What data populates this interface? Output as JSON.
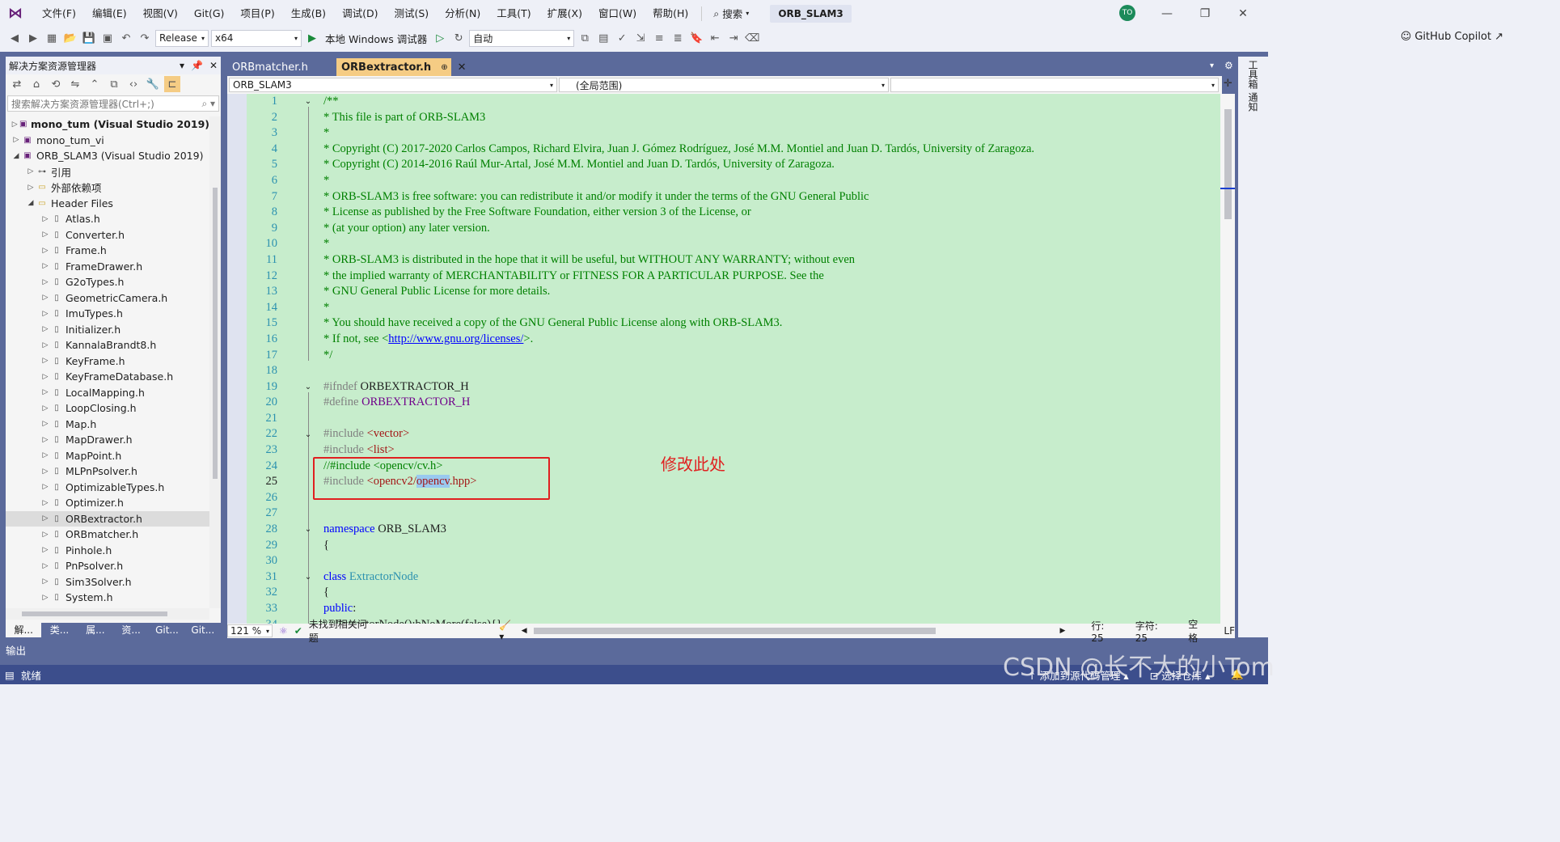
{
  "menubar": {
    "items": [
      "文件(F)",
      "编辑(E)",
      "视图(V)",
      "Git(G)",
      "项目(P)",
      "生成(B)",
      "调试(D)",
      "测试(S)",
      "分析(N)",
      "工具(T)",
      "扩展(X)",
      "窗口(W)",
      "帮助(H)"
    ],
    "search_label": "搜索",
    "solution_title": "ORB_SLAM3",
    "avatar_initials": "TO"
  },
  "toolbar": {
    "config": "Release",
    "platform": "x64",
    "debugger_label": "本地 Windows 调试器",
    "auto_combo": "自动",
    "copilot_label": "GitHub Copilot"
  },
  "solution_explorer": {
    "title": "解决方案资源管理器",
    "search_placeholder": "搜索解决方案资源管理器(Ctrl+;)",
    "items": [
      {
        "label": "mono_tum (Visual Studio 2019)",
        "bold": true,
        "arrow": "▷",
        "indent": 0,
        "icon": "project"
      },
      {
        "label": "mono_tum_vi",
        "bold": false,
        "arrow": "▷",
        "indent": 0,
        "icon": "project"
      },
      {
        "label": "ORB_SLAM3 (Visual Studio 2019)",
        "bold": false,
        "arrow": "◢",
        "indent": 0,
        "icon": "project"
      },
      {
        "label": "引用",
        "bold": false,
        "arrow": "▷",
        "indent": 1,
        "icon": "ref"
      },
      {
        "label": "外部依赖项",
        "bold": false,
        "arrow": "▷",
        "indent": 1,
        "icon": "folder"
      },
      {
        "label": "Header Files",
        "bold": false,
        "arrow": "◢",
        "indent": 1,
        "icon": "folder"
      },
      {
        "label": "Atlas.h",
        "bold": false,
        "arrow": "▷",
        "indent": 2,
        "icon": "file"
      },
      {
        "label": "Converter.h",
        "bold": false,
        "arrow": "▷",
        "indent": 2,
        "icon": "file"
      },
      {
        "label": "Frame.h",
        "bold": false,
        "arrow": "▷",
        "indent": 2,
        "icon": "file"
      },
      {
        "label": "FrameDrawer.h",
        "bold": false,
        "arrow": "▷",
        "indent": 2,
        "icon": "file"
      },
      {
        "label": "G2oTypes.h",
        "bold": false,
        "arrow": "▷",
        "indent": 2,
        "icon": "file"
      },
      {
        "label": "GeometricCamera.h",
        "bold": false,
        "arrow": "▷",
        "indent": 2,
        "icon": "file"
      },
      {
        "label": "ImuTypes.h",
        "bold": false,
        "arrow": "▷",
        "indent": 2,
        "icon": "file"
      },
      {
        "label": "Initializer.h",
        "bold": false,
        "arrow": "▷",
        "indent": 2,
        "icon": "file"
      },
      {
        "label": "KannalaBrandt8.h",
        "bold": false,
        "arrow": "▷",
        "indent": 2,
        "icon": "file"
      },
      {
        "label": "KeyFrame.h",
        "bold": false,
        "arrow": "▷",
        "indent": 2,
        "icon": "file"
      },
      {
        "label": "KeyFrameDatabase.h",
        "bold": false,
        "arrow": "▷",
        "indent": 2,
        "icon": "file"
      },
      {
        "label": "LocalMapping.h",
        "bold": false,
        "arrow": "▷",
        "indent": 2,
        "icon": "file"
      },
      {
        "label": "LoopClosing.h",
        "bold": false,
        "arrow": "▷",
        "indent": 2,
        "icon": "file"
      },
      {
        "label": "Map.h",
        "bold": false,
        "arrow": "▷",
        "indent": 2,
        "icon": "file"
      },
      {
        "label": "MapDrawer.h",
        "bold": false,
        "arrow": "▷",
        "indent": 2,
        "icon": "file"
      },
      {
        "label": "MapPoint.h",
        "bold": false,
        "arrow": "▷",
        "indent": 2,
        "icon": "file"
      },
      {
        "label": "MLPnPsolver.h",
        "bold": false,
        "arrow": "▷",
        "indent": 2,
        "icon": "file"
      },
      {
        "label": "OptimizableTypes.h",
        "bold": false,
        "arrow": "▷",
        "indent": 2,
        "icon": "file"
      },
      {
        "label": "Optimizer.h",
        "bold": false,
        "arrow": "▷",
        "indent": 2,
        "icon": "file"
      },
      {
        "label": "ORBextractor.h",
        "bold": false,
        "arrow": "▷",
        "indent": 2,
        "icon": "file",
        "selected": true
      },
      {
        "label": "ORBmatcher.h",
        "bold": false,
        "arrow": "▷",
        "indent": 2,
        "icon": "file"
      },
      {
        "label": "Pinhole.h",
        "bold": false,
        "arrow": "▷",
        "indent": 2,
        "icon": "file"
      },
      {
        "label": "PnPsolver.h",
        "bold": false,
        "arrow": "▷",
        "indent": 2,
        "icon": "file"
      },
      {
        "label": "Sim3Solver.h",
        "bold": false,
        "arrow": "▷",
        "indent": 2,
        "icon": "file"
      },
      {
        "label": "System.h",
        "bold": false,
        "arrow": "▷",
        "indent": 2,
        "icon": "file"
      }
    ],
    "bottom_tabs": [
      "解...",
      "类...",
      "属...",
      "资...",
      "Git...",
      "Git..."
    ]
  },
  "editor": {
    "tabs": [
      {
        "label": "ORBmatcher.h",
        "active": false
      },
      {
        "label": "ORBextractor.h",
        "active": true
      }
    ],
    "nav_project": "ORB_SLAM3",
    "nav_scope": "(全局范围)",
    "nav_member": "",
    "current_line": 25,
    "lines": [
      [
        [
          "c-comment",
          "/**"
        ]
      ],
      [
        [
          "c-comment",
          "* This file is part of ORB-SLAM3"
        ]
      ],
      [
        [
          "c-comment",
          "*"
        ]
      ],
      [
        [
          "c-comment",
          "* Copyright (C) 2017-2020 Carlos Campos, Richard Elvira, Juan J. Gómez Rodríguez, José M.M. Montiel and Juan D. Tardós, University of Zaragoza."
        ]
      ],
      [
        [
          "c-comment",
          "* Copyright (C) 2014-2016 Raúl Mur-Artal, José M.M. Montiel and Juan D. Tardós, University of Zaragoza."
        ]
      ],
      [
        [
          "c-comment",
          "*"
        ]
      ],
      [
        [
          "c-comment",
          "* ORB-SLAM3 is free software: you can redistribute it and/or modify it under the terms of the GNU General Public"
        ]
      ],
      [
        [
          "c-comment",
          "* License as published by the Free Software Foundation, either version 3 of the License, or"
        ]
      ],
      [
        [
          "c-comment",
          "* (at your option) any later version."
        ]
      ],
      [
        [
          "c-comment",
          "*"
        ]
      ],
      [
        [
          "c-comment",
          "* ORB-SLAM3 is distributed in the hope that it will be useful, but WITHOUT ANY WARRANTY; without even"
        ]
      ],
      [
        [
          "c-comment",
          "* the implied warranty of MERCHANTABILITY or FITNESS FOR A PARTICULAR PURPOSE. See the"
        ]
      ],
      [
        [
          "c-comment",
          "* GNU General Public License for more details."
        ]
      ],
      [
        [
          "c-comment",
          "*"
        ]
      ],
      [
        [
          "c-comment",
          "* You should have received a copy of the GNU General Public License along with ORB-SLAM3."
        ]
      ],
      [
        [
          "c-comment",
          "* If not, see <"
        ],
        [
          "c-link",
          "http://www.gnu.org/licenses/"
        ],
        [
          "c-comment",
          ">."
        ]
      ],
      [
        [
          "c-comment",
          "*/"
        ]
      ],
      [
        [
          "c-plain",
          ""
        ]
      ],
      [
        [
          "c-pre",
          "#ifndef "
        ],
        [
          "c-plain",
          "ORBEXTRACTOR_H"
        ]
      ],
      [
        [
          "c-pre",
          "#define "
        ],
        [
          "c-macro",
          "ORBEXTRACTOR_H"
        ]
      ],
      [
        [
          "c-plain",
          ""
        ]
      ],
      [
        [
          "c-pre",
          "#include "
        ],
        [
          "c-str",
          "<vector>"
        ]
      ],
      [
        [
          "c-pre",
          "#include "
        ],
        [
          "c-str",
          "<list>"
        ]
      ],
      [
        [
          "c-comment",
          "//#include <opencv/cv.h>"
        ]
      ],
      [
        [
          "c-pre",
          "#include "
        ],
        [
          "c-str",
          "<opencv2/"
        ],
        [
          "c-str c-hl",
          "opencv"
        ],
        [
          "c-str",
          ".hpp>"
        ]
      ],
      [
        [
          "c-plain",
          ""
        ]
      ],
      [
        [
          "c-plain",
          ""
        ]
      ],
      [
        [
          "c-kw",
          "namespace "
        ],
        [
          "c-plain",
          "ORB_SLAM3"
        ]
      ],
      [
        [
          "c-plain",
          "{"
        ]
      ],
      [
        [
          "c-plain",
          ""
        ]
      ],
      [
        [
          "c-kw",
          "class "
        ],
        [
          "c-type",
          "ExtractorNode"
        ]
      ],
      [
        [
          "c-plain",
          "{"
        ]
      ],
      [
        [
          "c-kw",
          "public"
        ],
        [
          "c-plain",
          ":"
        ]
      ],
      [
        [
          "c-plain",
          "    ExtractorNode():bNoMore(false){}"
        ]
      ]
    ],
    "annotation": "修改此处"
  },
  "editor_status": {
    "zoom": "121 %",
    "issues": "未找到相关问题",
    "line": "行: 25",
    "char": "字符: 25",
    "space": "空格",
    "eol": "LF"
  },
  "right_strip": [
    "工具箱",
    "通知"
  ],
  "output_label": "输出",
  "statusbar": {
    "ready": "就绪",
    "add_source": "添加到源代码管理",
    "select_repo": "选择仓库"
  },
  "watermark": "CSDN @长不大的小Tom",
  "colors": {
    "editor_bg": "#c7edcc",
    "active_tab": "#f5cc84",
    "chrome": "#5b6a9b",
    "statusbar": "#3c4e8c",
    "annotation_red": "#e02020"
  }
}
